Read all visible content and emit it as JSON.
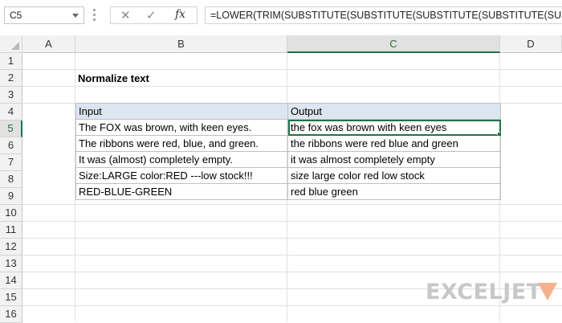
{
  "formula_bar": {
    "name_box": "C5",
    "cancel_icon": "✕",
    "enter_icon": "✓",
    "fx_label": "fx",
    "formula": "=LOWER(TRIM(SUBSTITUTE(SUBSTITUTE(SUBSTITUTE(SUBSTITUTE(SUBST"
  },
  "columns": [
    "A",
    "B",
    "C",
    "D"
  ],
  "selected_column": "C",
  "rows": [
    "1",
    "2",
    "3",
    "4",
    "5",
    "6",
    "7",
    "8",
    "9",
    "10",
    "11",
    "12",
    "13",
    "14",
    "15",
    "16"
  ],
  "selected_row": "5",
  "sheet": {
    "title": "Normalize text",
    "headers": {
      "input": "Input",
      "output": "Output"
    },
    "data": [
      {
        "input": "The FOX was brown, with keen eyes.",
        "output": "the fox was brown with keen eyes"
      },
      {
        "input": "The ribbons were red, blue, and green.",
        "output": "the ribbons were red blue and green"
      },
      {
        "input": "It was (almost) completely empty.",
        "output": "it was almost completely empty"
      },
      {
        "input": "Size:LARGE color:RED ---low stock!!!",
        "output": "size large color red low stock"
      },
      {
        "input": "RED-BLUE-GREEN",
        "output": "red blue green"
      }
    ]
  },
  "logo": {
    "text": "EXCELJET"
  },
  "colors": {
    "accent": "#217346",
    "table_header": "#dce6f1",
    "logo_mark": "#f5b18b"
  }
}
